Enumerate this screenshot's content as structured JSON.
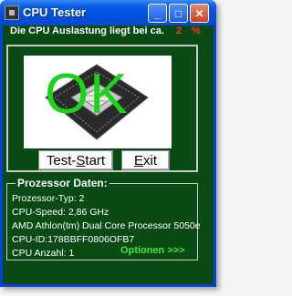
{
  "window": {
    "title": "CPU Tester",
    "minimize_label": "_",
    "maximize_label": "□",
    "close_label": "✕"
  },
  "usage": {
    "text": "Die CPU Auslastung liegt bei ca.",
    "value": "2",
    "unit": "%"
  },
  "status": {
    "ok_label": "OK",
    "image": "cpu-chip-icon"
  },
  "buttons": {
    "start_prefix": "Test-",
    "start_mnemonic": "S",
    "start_suffix": "tart",
    "exit_mnemonic": "E",
    "exit_suffix": "xit"
  },
  "processor": {
    "heading": "Prozessor Daten:",
    "lines": [
      "Prozessor-Typ: 2",
      "CPU-Speed: 2,86 GHz",
      "AMD Athlon(tm) Dual Core Processor 5050e",
      "CPU-ID:178BBFF0806OFB7",
      "CPU Anzahl: 1"
    ],
    "options_link": "Optionen >>>"
  },
  "colors": {
    "background": "#0a4a14",
    "ok": "#19d419",
    "usage_value": "#ff3030",
    "options": "#3ce83c"
  }
}
